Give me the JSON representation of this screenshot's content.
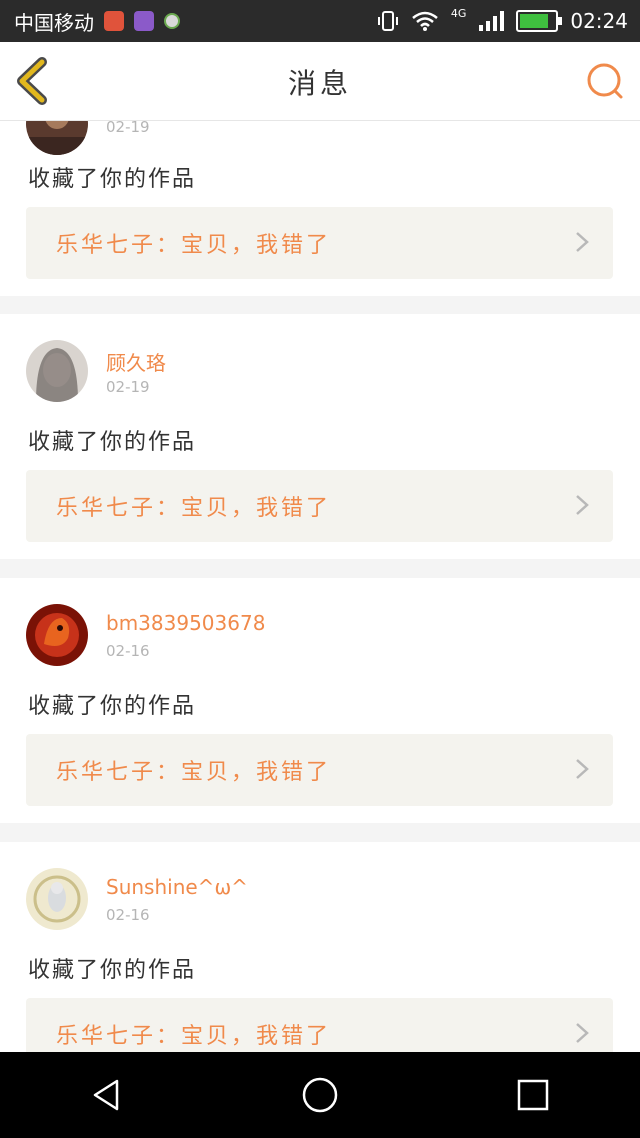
{
  "status_bar": {
    "carrier": "中国移动",
    "network": "4G",
    "time": "02:24",
    "battery_level": 0.8
  },
  "header": {
    "title": "消息"
  },
  "notifications": [
    {
      "username": "",
      "date": "02-19",
      "action": "收藏了你的作品",
      "quote": "乐华七子：宝贝，我错了"
    },
    {
      "username": "顾久珞",
      "date": "02-19",
      "action": "收藏了你的作品",
      "quote": "乐华七子：宝贝，我错了"
    },
    {
      "username": "bm3839503678",
      "date": "02-16",
      "action": "收藏了你的作品",
      "quote": "乐华七子：宝贝，我错了"
    },
    {
      "username": "Sunshine^ω^",
      "date": "02-16",
      "action": "收藏了你的作品",
      "quote": "乐华七子：宝贝，我错了"
    }
  ],
  "colors": {
    "accent": "#f08a4b",
    "back_icon": "#e2b81e",
    "quote_bg": "#f4f3ee"
  }
}
